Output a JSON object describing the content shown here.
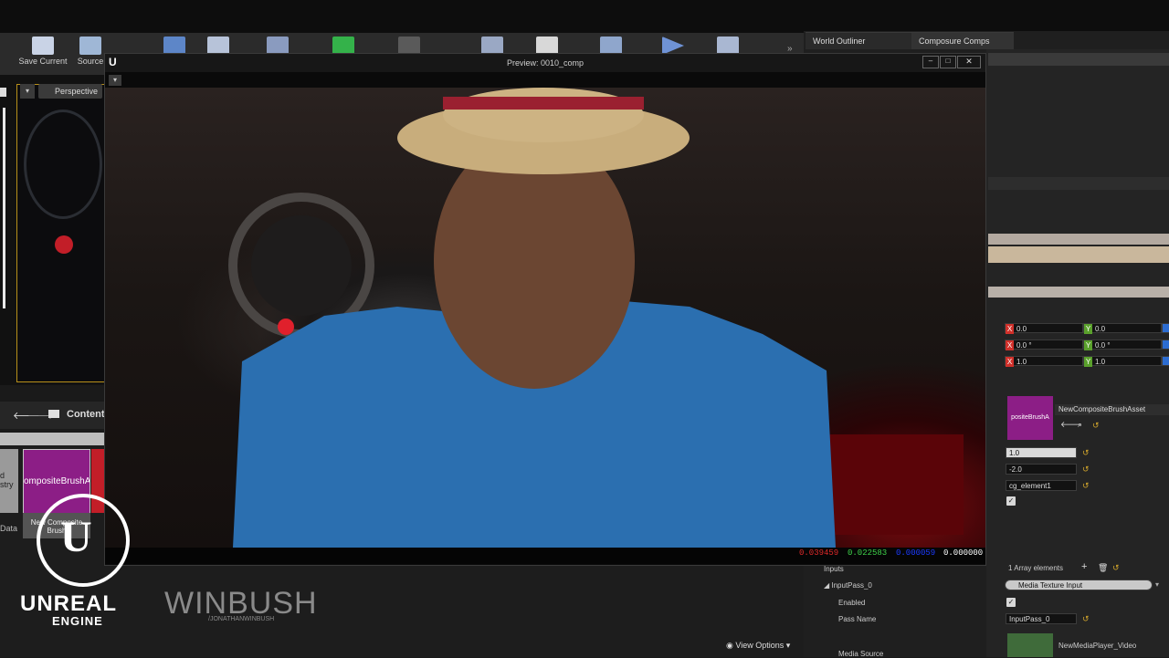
{
  "toolbar": {
    "items": [
      {
        "label": "Save Current",
        "icon": "save-icon"
      },
      {
        "label": "Source",
        "icon": "source-control-icon"
      },
      {
        "label": "",
        "icon": "content-icon"
      },
      {
        "label": "",
        "icon": "marketplace-icon"
      },
      {
        "label": "",
        "icon": "settings-icon"
      },
      {
        "label": "",
        "icon": "modes-icon"
      },
      {
        "label": "",
        "icon": "cinematics-icon"
      },
      {
        "label": "",
        "icon": "blueprints-icon"
      },
      {
        "label": "",
        "icon": "build-icon"
      },
      {
        "label": "",
        "icon": "sequencer-icon"
      },
      {
        "label": "",
        "icon": "play-icon"
      },
      {
        "label": "",
        "icon": "launch-icon"
      }
    ]
  },
  "tabs": {
    "world_outliner": "World Outliner",
    "composure": "Composure Comps"
  },
  "viewport": {
    "perspective_label": "Perspective"
  },
  "content_browser": {
    "title": "Content",
    "asset_label": "New Composite Brush",
    "asset_thumb_text": "ompositeBrushAs",
    "left_labels": [
      "d",
      "stry",
      "Data"
    ]
  },
  "preview": {
    "title": "Preview: 0010_comp",
    "pixel_values": {
      "r": "0.039459",
      "g": "0.022583",
      "b": "0.000059",
      "a": "0.000000"
    }
  },
  "details": {
    "location": {
      "x": "0.0",
      "y": "0.0"
    },
    "rotation": {
      "x": "0.0 °",
      "y": "0.0 °"
    },
    "scale": {
      "x": "1.0",
      "y": "1.0"
    },
    "brush_asset": "NewCompositeBrushAsset",
    "brush_thumb_text": "positeBrushA",
    "field1": "1.0",
    "field2": "-2.0",
    "element_name": "cg_element1",
    "inputs_label": "Inputs",
    "array_elements": "1 Array elements",
    "input_pass": "InputPass_0",
    "media_texture": "Media Texture Input",
    "enabled_label": "Enabled",
    "pass_name_label": "Pass Name",
    "pass_name_value": "InputPass_0",
    "media_source_label": "Media Source",
    "media_player": "NewMediaPlayer_Video",
    "view_options": "View Options"
  },
  "overlay": {
    "engine_line1": "UNREAL",
    "engine_line2": "ENGINE",
    "brand": "WINBUSH",
    "brand_handle": "/JONATHANWINBUSH"
  },
  "colors": {
    "accent": "#b8901a",
    "asset_purple": "#8c1e86",
    "red": "#e02a2a",
    "green": "#3fd34a",
    "blue": "#1c3cff"
  }
}
